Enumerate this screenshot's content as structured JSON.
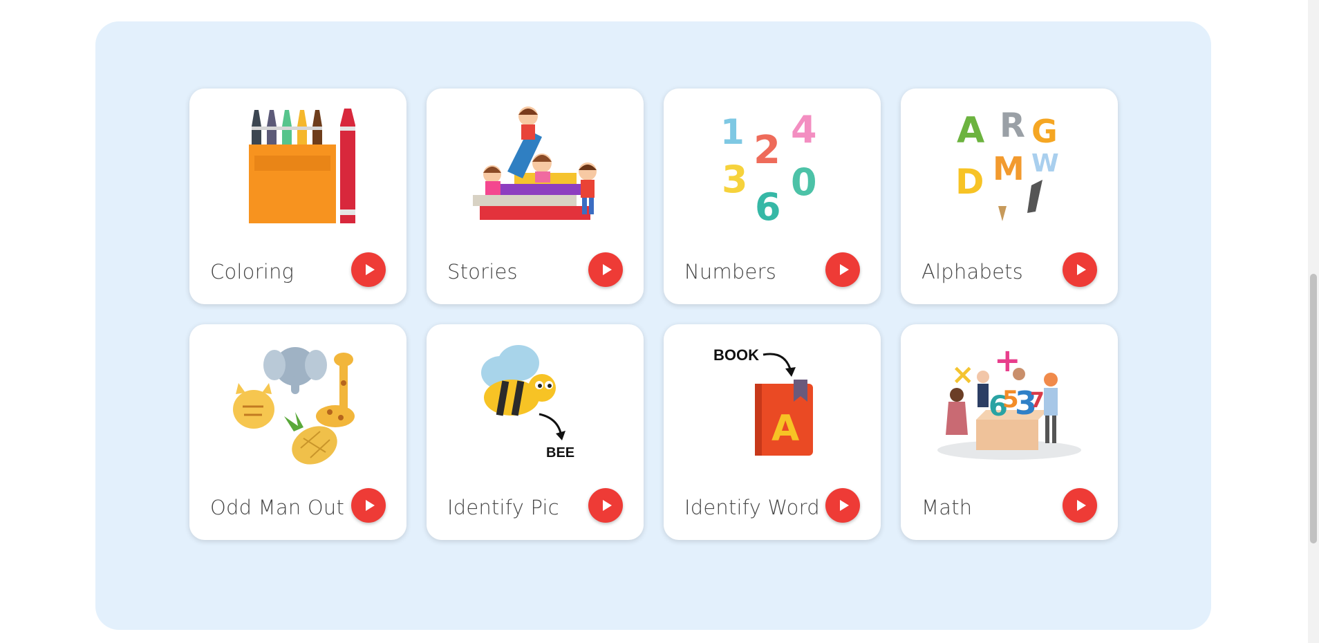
{
  "cards": [
    {
      "title": "Coloring",
      "icon": "crayons-icon"
    },
    {
      "title": "Stories",
      "icon": "kids-reading-books-icon"
    },
    {
      "title": "Numbers",
      "icon": "cartoon-numbers-icon"
    },
    {
      "title": "Alphabets",
      "icon": "animal-letters-icon"
    },
    {
      "title": "Odd Man Out",
      "icon": "animals-and-pineapple-icon"
    },
    {
      "title": "Identify Pic",
      "icon": "bee-picture-icon"
    },
    {
      "title": "Identify Word",
      "icon": "book-word-icon"
    },
    {
      "title": "Math",
      "icon": "math-kids-icon"
    }
  ],
  "illustration_text": {
    "bee_caption": "BEE",
    "book_caption": "BOOK",
    "book_letter": "A",
    "numbers": [
      "1",
      "2",
      "4",
      "3",
      "0",
      "6"
    ],
    "letters": [
      "A",
      "R",
      "G",
      "M",
      "W",
      "D"
    ],
    "math_symbols": [
      "×",
      "+",
      "3",
      "6",
      "5",
      "7"
    ]
  },
  "colors": {
    "panel_bg": "#e3f0fc",
    "card_bg": "#ffffff",
    "play_button": "#ee3b36",
    "title_text": "#444444"
  }
}
